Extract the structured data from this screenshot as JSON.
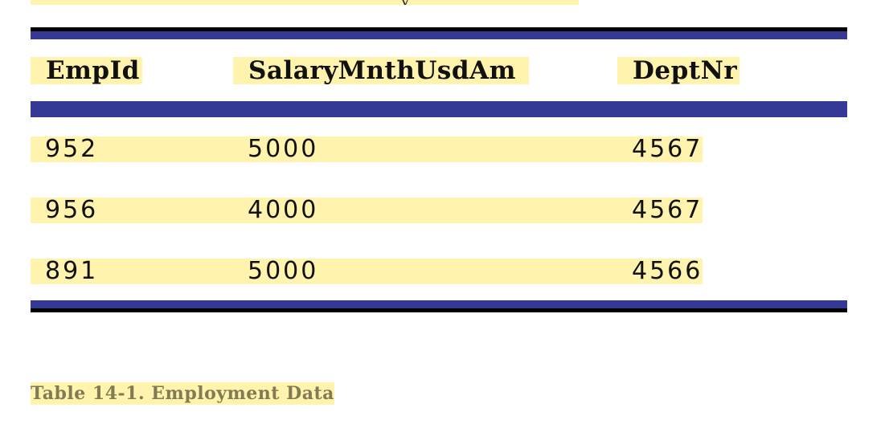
{
  "table": {
    "headers": [
      "EmpId",
      "SalaryMnthUsdAm",
      "DeptNr"
    ],
    "rows": [
      [
        "952",
        "5000",
        "4567"
      ],
      [
        "956",
        "4000",
        "4567"
      ],
      [
        "891",
        "5000",
        "4566"
      ]
    ]
  },
  "caption": "Table 14-1. Employment Data",
  "colors": {
    "rule_blue": "#363896",
    "rule_black": "#000000",
    "highlight": "#fff3ad",
    "caption_text": "#827a52"
  }
}
